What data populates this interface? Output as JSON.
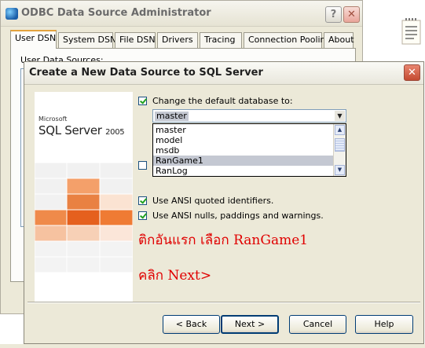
{
  "background_window": {
    "title": "ODBC Data Source Administrator",
    "help_label": "?",
    "close_label": "✕",
    "tabs": [
      "User DSN",
      "System DSN",
      "File DSN",
      "Drivers",
      "Tracing",
      "Connection Pooling",
      "About"
    ],
    "panel_label": "User Data Sources:"
  },
  "dialog": {
    "title": "Create a New Data Source to SQL Server",
    "close_label": "✕",
    "logo": {
      "brand": "Microsoft",
      "product": "SQL Server",
      "version": "2005"
    },
    "change_db": {
      "label": "Change the default database to:",
      "checked": true
    },
    "database_combo": {
      "value": "master",
      "arrow": "▼"
    },
    "database_options": [
      "master",
      "model",
      "msdb",
      "RanGame1",
      "RanLog"
    ],
    "selected_option": "RanGame1",
    "hidden_checkbox_checked": false,
    "ansi_quoted": {
      "label": "Use ANSI quoted identifiers.",
      "checked": true
    },
    "ansi_nulls": {
      "label": "Use ANSI nulls, paddings and warnings.",
      "checked": true
    },
    "annotations": [
      "ติกอันแรก เลือก RanGame1",
      "คลิก Next>"
    ],
    "annotation_color": "#e00000",
    "buttons": {
      "back": "< Back",
      "next": "Next >",
      "cancel": "Cancel",
      "help": "Help"
    }
  },
  "icons": {
    "app": "odbc-globe-icon",
    "doc": "document-icon",
    "scroll_up": "▲",
    "scroll_down": "▼"
  }
}
